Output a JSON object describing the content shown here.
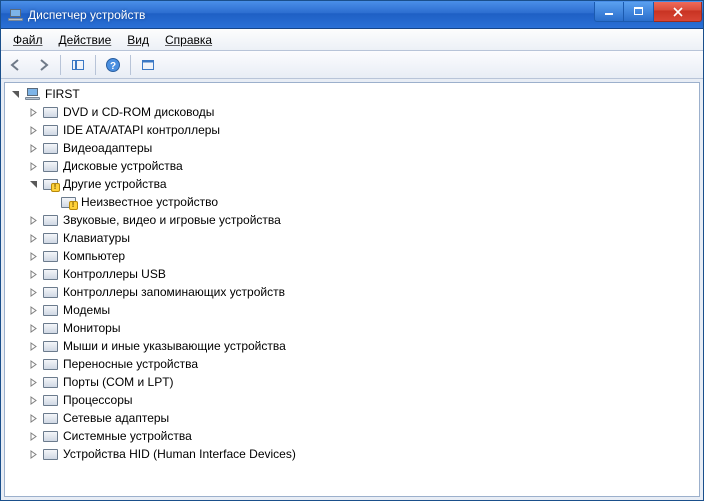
{
  "window": {
    "title": "Диспетчер устройств"
  },
  "menus": {
    "file": "Файл",
    "action": "Действие",
    "view": "Вид",
    "help": "Справка"
  },
  "root": {
    "label": "FIRST"
  },
  "categories": [
    {
      "label": "DVD и CD-ROM дисководы"
    },
    {
      "label": "IDE ATA/ATAPI контроллеры"
    },
    {
      "label": "Видеоадаптеры"
    },
    {
      "label": "Дисковые устройства"
    },
    {
      "label": "Другие устройства",
      "expanded": true,
      "warn": true,
      "children": [
        {
          "label": "Неизвестное устройство",
          "warn": true
        }
      ]
    },
    {
      "label": "Звуковые, видео и игровые устройства"
    },
    {
      "label": "Клавиатуры"
    },
    {
      "label": "Компьютер"
    },
    {
      "label": "Контроллеры USB"
    },
    {
      "label": "Контроллеры запоминающих устройств"
    },
    {
      "label": "Модемы"
    },
    {
      "label": "Мониторы"
    },
    {
      "label": "Мыши и иные указывающие устройства"
    },
    {
      "label": "Переносные устройства"
    },
    {
      "label": "Порты (COM и LPT)"
    },
    {
      "label": "Процессоры"
    },
    {
      "label": "Сетевые адаптеры"
    },
    {
      "label": "Системные устройства"
    },
    {
      "label": "Устройства HID (Human Interface Devices)"
    }
  ]
}
